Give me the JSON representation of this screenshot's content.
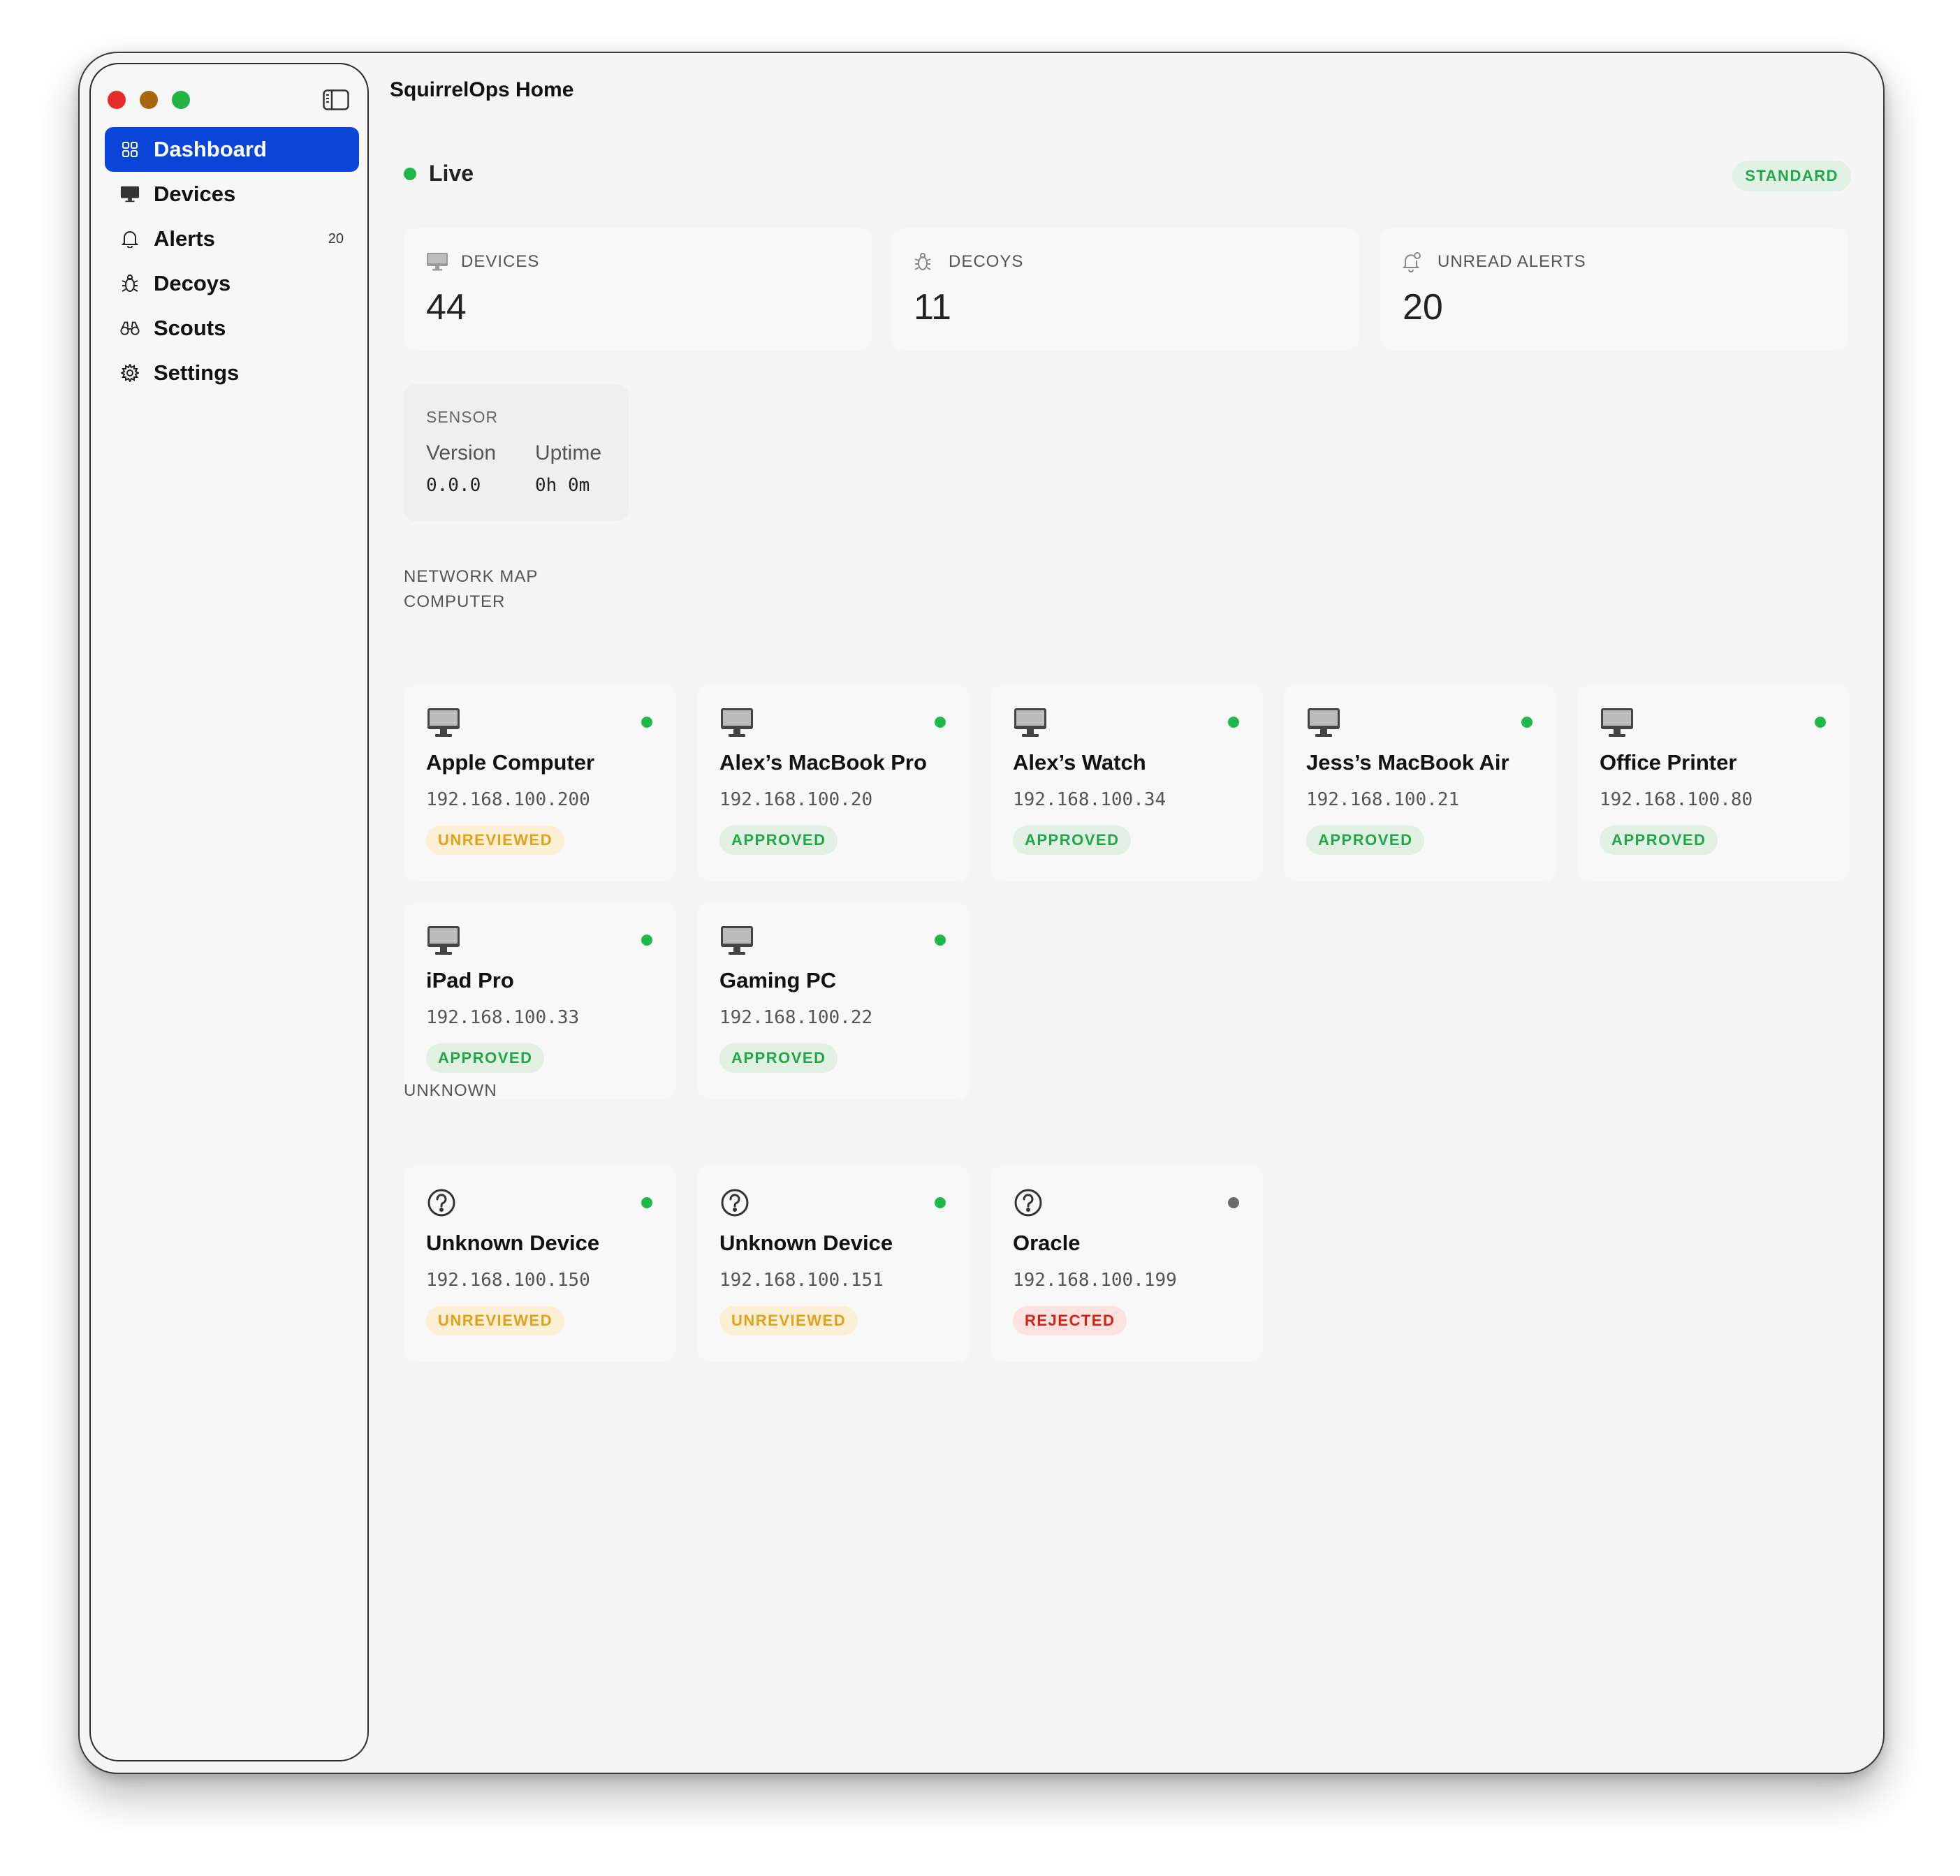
{
  "window": {
    "title": "SquirrelOps Home"
  },
  "sidebar": {
    "items": [
      {
        "label": "Dashboard",
        "icon": "grid-icon",
        "active": true
      },
      {
        "label": "Devices",
        "icon": "monitor-icon"
      },
      {
        "label": "Alerts",
        "icon": "bell-icon",
        "badge": "20"
      },
      {
        "label": "Decoys",
        "icon": "bug-icon"
      },
      {
        "label": "Scouts",
        "icon": "binoculars-icon"
      },
      {
        "label": "Settings",
        "icon": "gear-icon"
      }
    ]
  },
  "status": {
    "live_label": "Live",
    "mode_badge": "STANDARD",
    "live_color": "#1fb84a"
  },
  "stats": {
    "devices": {
      "label": "DEVICES",
      "value": "44"
    },
    "decoys": {
      "label": "DECOYS",
      "value": "11"
    },
    "alerts": {
      "label": "UNREAD ALERTS",
      "value": "20"
    }
  },
  "sensor": {
    "label": "SENSOR",
    "version_label": "Version",
    "version": "0.0.0",
    "uptime_label": "Uptime",
    "uptime": "0h 0m"
  },
  "network_map": {
    "label": "NETWORK MAP",
    "computer_label": "COMPUTER",
    "unknown_label": "UNKNOWN",
    "computers": [
      {
        "name": "Apple Computer",
        "ip": "192.168.100.200",
        "status": "UNREVIEWED",
        "online": true
      },
      {
        "name": "Alex’s MacBook Pro",
        "ip": "192.168.100.20",
        "status": "APPROVED",
        "online": true
      },
      {
        "name": "Alex’s Watch",
        "ip": "192.168.100.34",
        "status": "APPROVED",
        "online": true
      },
      {
        "name": "Jess’s MacBook Air",
        "ip": "192.168.100.21",
        "status": "APPROVED",
        "online": true
      },
      {
        "name": "Office Printer",
        "ip": "192.168.100.80",
        "status": "APPROVED",
        "online": true
      },
      {
        "name": "iPad Pro",
        "ip": "192.168.100.33",
        "status": "APPROVED",
        "online": true
      },
      {
        "name": "Gaming PC",
        "ip": "192.168.100.22",
        "status": "APPROVED",
        "online": true
      }
    ],
    "unknown": [
      {
        "name": "Unknown Device",
        "ip": "192.168.100.150",
        "status": "UNREVIEWED",
        "online": true
      },
      {
        "name": "Unknown Device",
        "ip": "192.168.100.151",
        "status": "UNREVIEWED",
        "online": true
      },
      {
        "name": "Oracle",
        "ip": "192.168.100.199",
        "status": "REJECTED",
        "online": false
      }
    ]
  },
  "colors": {
    "accent": "#0a45d8",
    "online": "#1fb84a",
    "offline": "#6b6b6b"
  }
}
